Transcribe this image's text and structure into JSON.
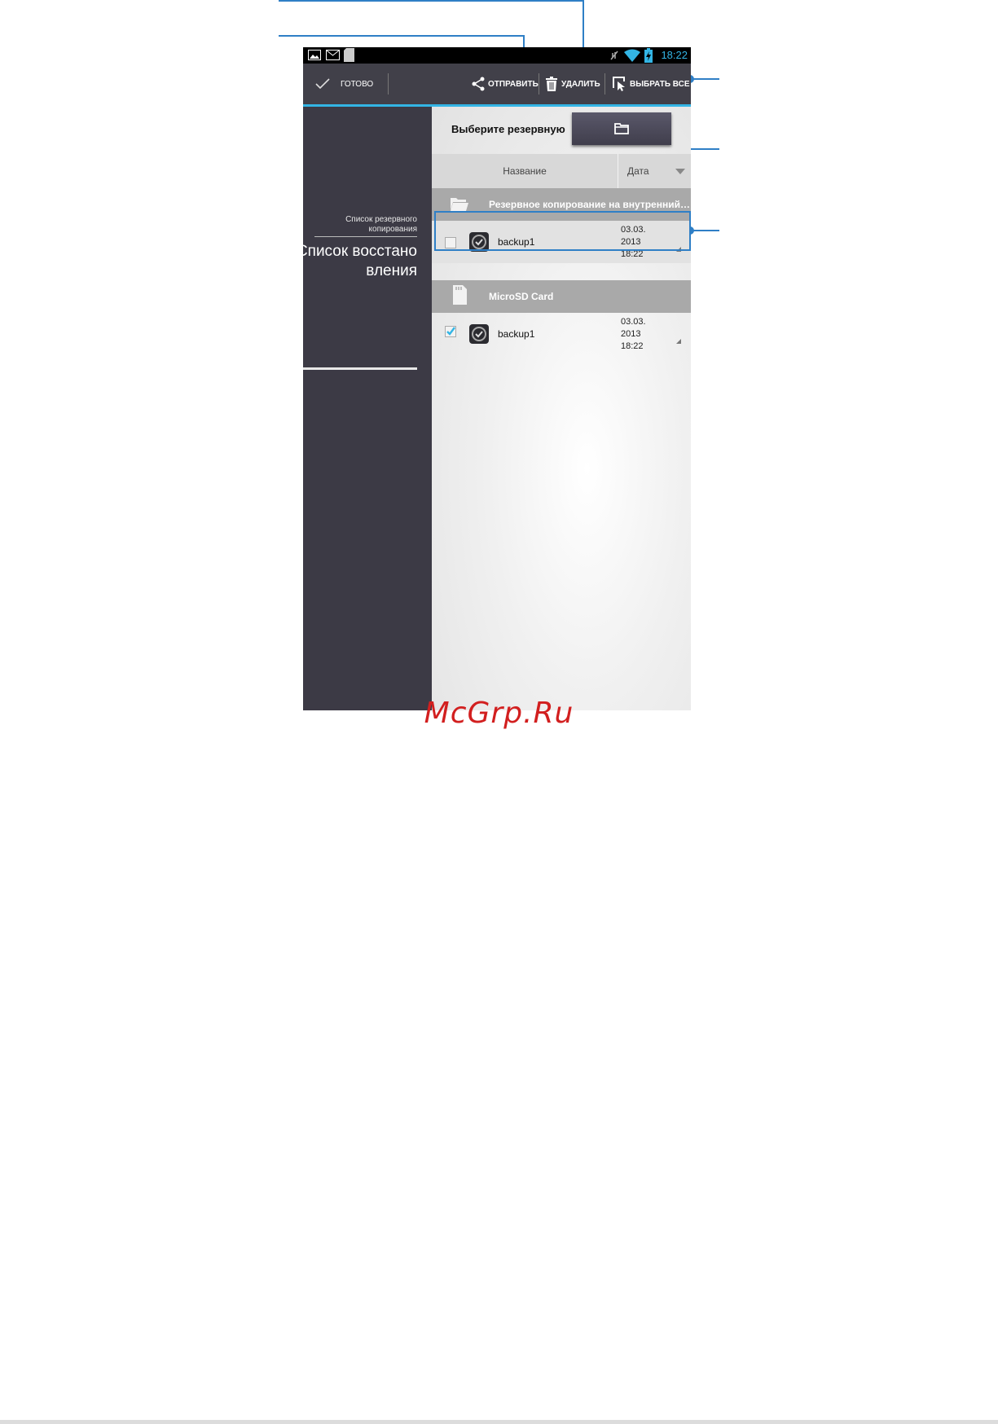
{
  "statusbar": {
    "time": "18:22"
  },
  "actionbar": {
    "done_label": "ГОТОВО",
    "send_label": "ОТПРАВИТЬ",
    "delete_label": "УДАЛИТЬ",
    "select_all_label": "ВЫБРАТЬ ВСЕ"
  },
  "sidebar": {
    "backup_list_label": "Список резервного копирования",
    "restore_list_label": "Список восстановления"
  },
  "main": {
    "prompt": "Выберите резервную",
    "columns": {
      "name": "Название",
      "date": "Дата"
    },
    "groups": [
      {
        "label": "Резервное копирование на внутренний…",
        "rows": [
          {
            "name": "backup1",
            "date_line1": "03.03.",
            "date_line2": "2013",
            "date_line3": "18:22",
            "checked": false
          }
        ]
      },
      {
        "label": "MicroSD Card",
        "rows": [
          {
            "name": "backup1",
            "date_line1": "03.03.",
            "date_line2": "2013",
            "date_line3": "18:22",
            "checked": true
          }
        ]
      }
    ]
  },
  "watermark": "McGrp.Ru",
  "colors": {
    "accent": "#33b5e5",
    "callout": "#2f7fc6",
    "watermark": "#d21f1f"
  }
}
